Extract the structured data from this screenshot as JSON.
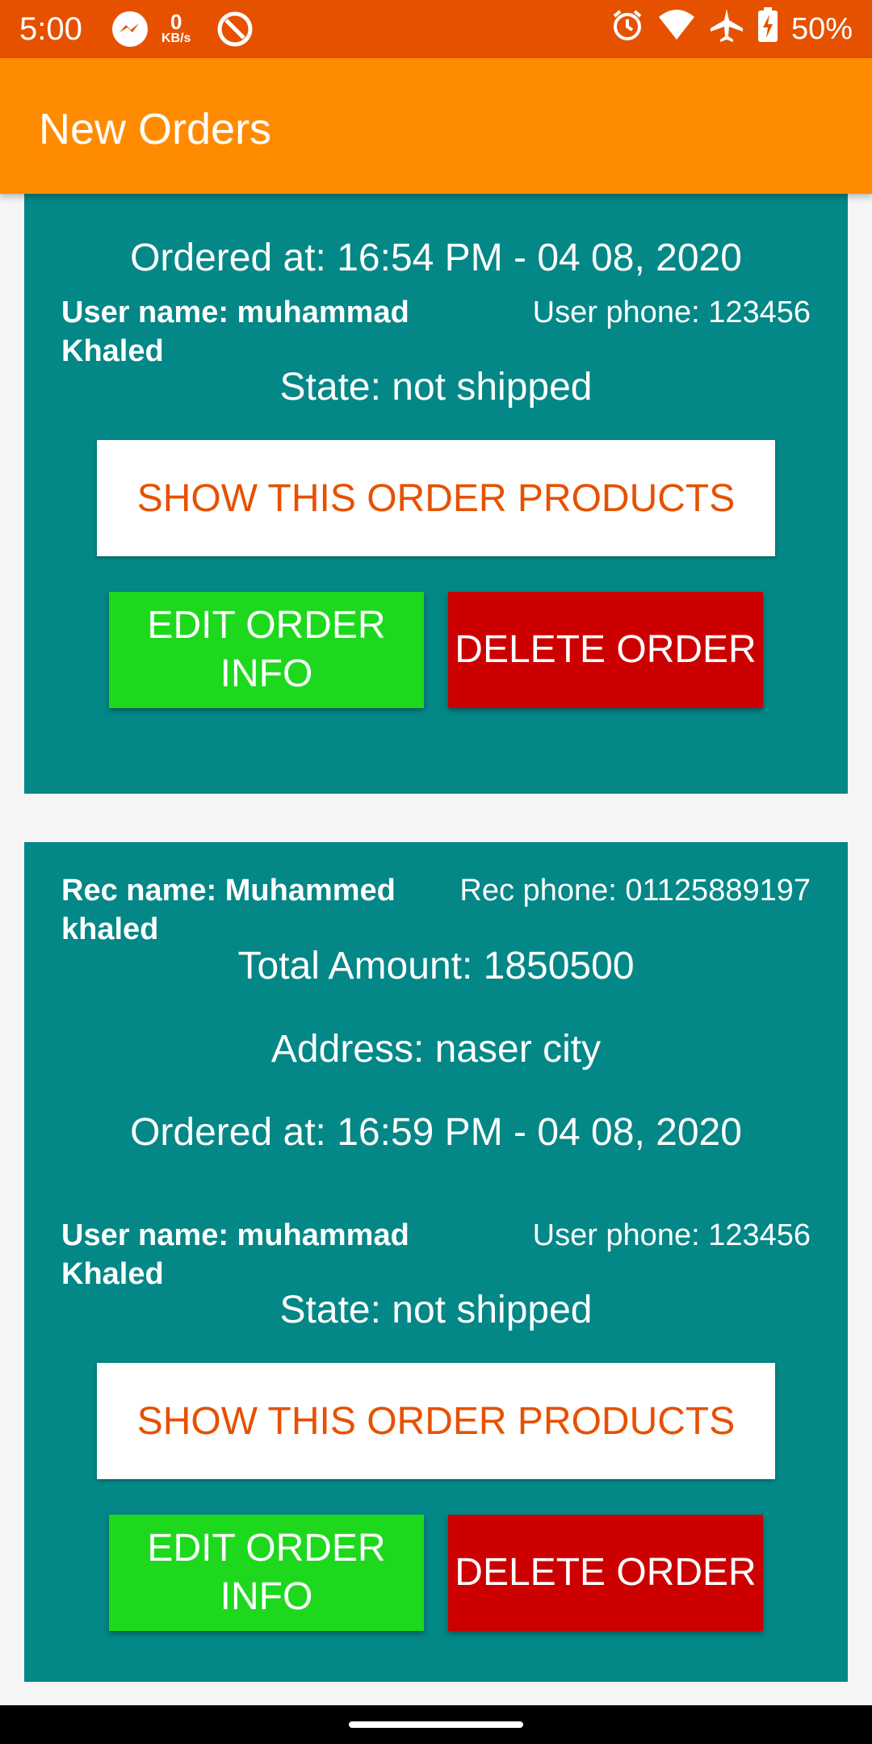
{
  "status_bar": {
    "time": "5:00",
    "net_speed_value": "0",
    "net_speed_unit": "KB/s",
    "battery": "50%",
    "icons": [
      "messenger-icon",
      "netspeed-icon",
      "hotspot-icon",
      "alarm-icon",
      "wifi-icon",
      "airplane-icon",
      "battery-charging-icon"
    ]
  },
  "app_bar": {
    "title": "New Orders"
  },
  "orders": [
    {
      "ordered_at": "Ordered at: 16:54 PM - 04 08, 2020",
      "user_name": "User name: muhammad Khaled",
      "user_phone": "User phone: 123456",
      "state": "State: not shipped",
      "show_label": "SHOW THIS ORDER PRODUCTS",
      "edit_label": "EDIT ORDER INFO",
      "delete_label": "DELETE ORDER"
    },
    {
      "rec_name": "Rec name: Muhammed khaled",
      "rec_phone": "Rec phone: 01125889197",
      "total": "Total Amount: 1850500",
      "address": "Address: naser city",
      "ordered_at": "Ordered at: 16:59 PM - 04 08, 2020",
      "user_name": "User name: muhammad Khaled",
      "user_phone": "User phone: 123456",
      "state": "State: not shipped",
      "show_label": "SHOW THIS ORDER PRODUCTS",
      "edit_label": "EDIT ORDER INFO",
      "delete_label": "DELETE ORDER"
    }
  ],
  "colors": {
    "status_bar": "#e65100",
    "app_bar": "#ff8c00",
    "card": "#048787",
    "edit": "#1ed81e",
    "delete": "#cc0000",
    "show_text": "#e65100"
  }
}
